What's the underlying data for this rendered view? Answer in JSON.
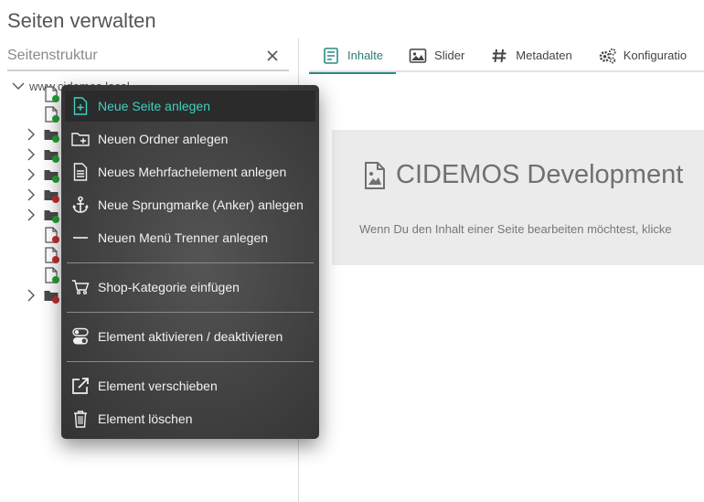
{
  "page": {
    "title": "Seiten verwalten"
  },
  "sidebar": {
    "search": {
      "placeholder": "Seitenstruktur",
      "value": ""
    },
    "root": {
      "label": "www.cidemos.local"
    },
    "nodes": [
      {
        "kind": "doc",
        "status": "green"
      },
      {
        "kind": "doc",
        "status": "green"
      },
      {
        "kind": "folder",
        "status": "green"
      },
      {
        "kind": "folder",
        "status": "green"
      },
      {
        "kind": "folder",
        "status": "green"
      },
      {
        "kind": "folder",
        "status": "red"
      },
      {
        "kind": "folder",
        "status": "green"
      },
      {
        "kind": "doc",
        "status": "red"
      },
      {
        "kind": "doc",
        "status": "red"
      },
      {
        "kind": "doc",
        "status": "green"
      },
      {
        "kind": "folder",
        "status": "red"
      }
    ]
  },
  "tabs": [
    {
      "label": "Inhalte",
      "icon": "content-list-icon",
      "active": true
    },
    {
      "label": "Slider",
      "icon": "image-icon",
      "active": false
    },
    {
      "label": "Metadaten",
      "icon": "hash-icon",
      "active": false
    },
    {
      "label": "Konfiguratio",
      "icon": "gears-icon",
      "active": false
    }
  ],
  "content": {
    "title": "CIDEMOS Development",
    "text": "Wenn Du den Inhalt einer Seite bearbeiten möchtest, klicke"
  },
  "context_menu": {
    "items": [
      {
        "label": "Neue Seite anlegen",
        "icon": "new-page-icon",
        "highlight": true
      },
      {
        "label": "Neuen Ordner anlegen",
        "icon": "new-folder-icon"
      },
      {
        "label": "Neues Mehrfachelement anlegen",
        "icon": "multi-element-icon"
      },
      {
        "label": "Neue Sprungmarke (Anker) anlegen",
        "icon": "anchor-icon"
      },
      {
        "label": "Neuen Menü Trenner anlegen",
        "icon": "separator-line-icon"
      },
      {
        "label": "Shop-Kategorie einfügen",
        "icon": "cart-icon"
      },
      {
        "label": "Element aktivieren / deaktivieren",
        "icon": "toggle-icon"
      },
      {
        "label": "Element verschieben",
        "icon": "move-external-icon"
      },
      {
        "label": "Element löschen",
        "icon": "trash-icon"
      }
    ]
  },
  "colors": {
    "accent": "#2a8b80",
    "menu_highlight_text": "#3fd1c2",
    "status_green": "#22a033",
    "status_red": "#c22e2e"
  }
}
